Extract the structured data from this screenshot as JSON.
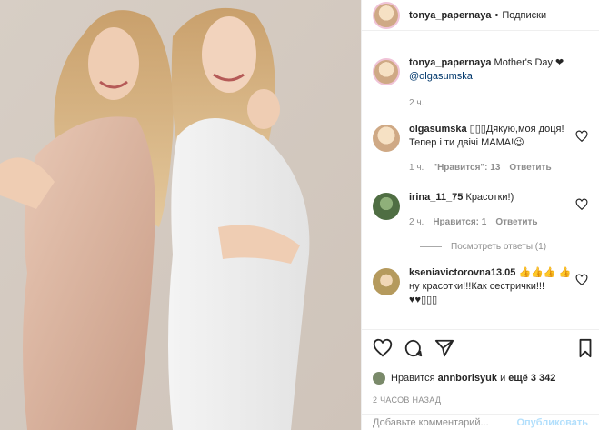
{
  "header": {
    "username": "tonya_papernaya",
    "dot": "•",
    "follow_label": "Подписки"
  },
  "caption": {
    "username": "tonya_papernaya",
    "text": "Mother's Day ❤",
    "mention": "@olgasumska",
    "time": "2 ч."
  },
  "comments": [
    {
      "username": "olgasumska",
      "text": "▯▯▯Дякую,моя доця!Тепер і ти двічі МАМА!😉",
      "time": "1 ч.",
      "likes": "\"Нравится\": 13",
      "reply": "Ответить",
      "avatar_color": "#e7c9a6"
    },
    {
      "username": "irina_11_75",
      "text": "Красотки!)",
      "time": "2 ч.",
      "likes": "Нравится: 1",
      "reply": "Ответить",
      "avatar_color": "#5a7c4e"
    },
    {
      "username": "kseniavictorovna13.05",
      "text": "👍👍👍 👍ну красотки!!!Как сестрички!!! ♥♥▯▯▯",
      "avatar_color": "#b9a36b"
    }
  ],
  "replies_link": "Посмотреть ответы (1)",
  "likes": {
    "prefix": "Нравится",
    "user": "annborisyuk",
    "mid": "и",
    "rest": "ещё 3 342"
  },
  "post_time": "2 ЧАСОВ НАЗАД",
  "comment_box": {
    "placeholder": "Добавьте комментарий...",
    "publish": "Опубликовать"
  },
  "icons": [
    "heart-icon",
    "comment-icon",
    "share-icon",
    "bookmark-icon"
  ],
  "colors": {
    "accent_red": "#ed4956",
    "link_blue": "#00376b",
    "muted": "#8e8e8e"
  }
}
